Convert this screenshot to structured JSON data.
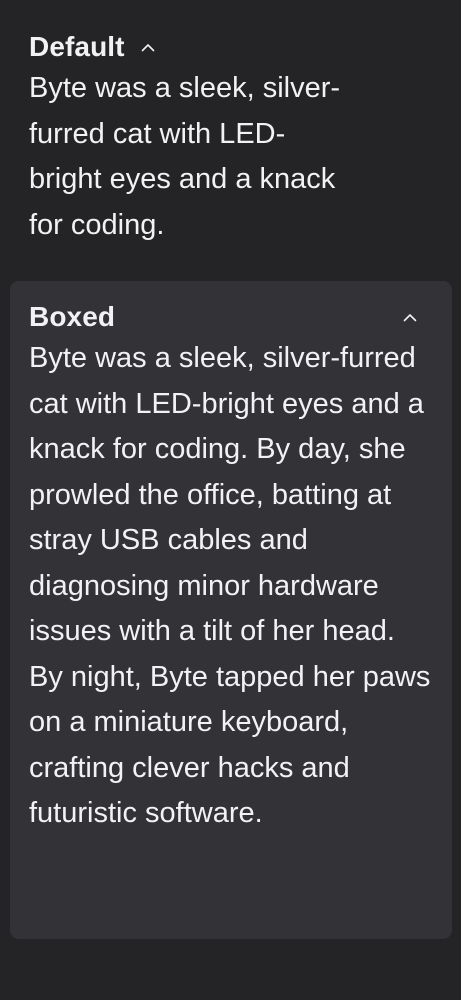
{
  "sections": {
    "default": {
      "title": "Default",
      "body": "Byte was a sleek, silver-furred cat with LED-bright eyes and a knack for coding.",
      "chevron_icon": "chevron-up-icon"
    },
    "boxed": {
      "title": "Boxed",
      "body": "Byte was a sleek, silver-furred cat with LED-bright eyes and a knack for coding. By day, she prowled the office, batting at stray USB cables and diagnosing minor hardware issues with a tilt of her head. By night, Byte tapped her paws on a miniature keyboard, crafting clever hacks and futuristic software.",
      "chevron_icon": "chevron-up-icon"
    }
  },
  "colors": {
    "background": "#242427",
    "box_background": "#333337",
    "text": "#f2f2f4"
  }
}
